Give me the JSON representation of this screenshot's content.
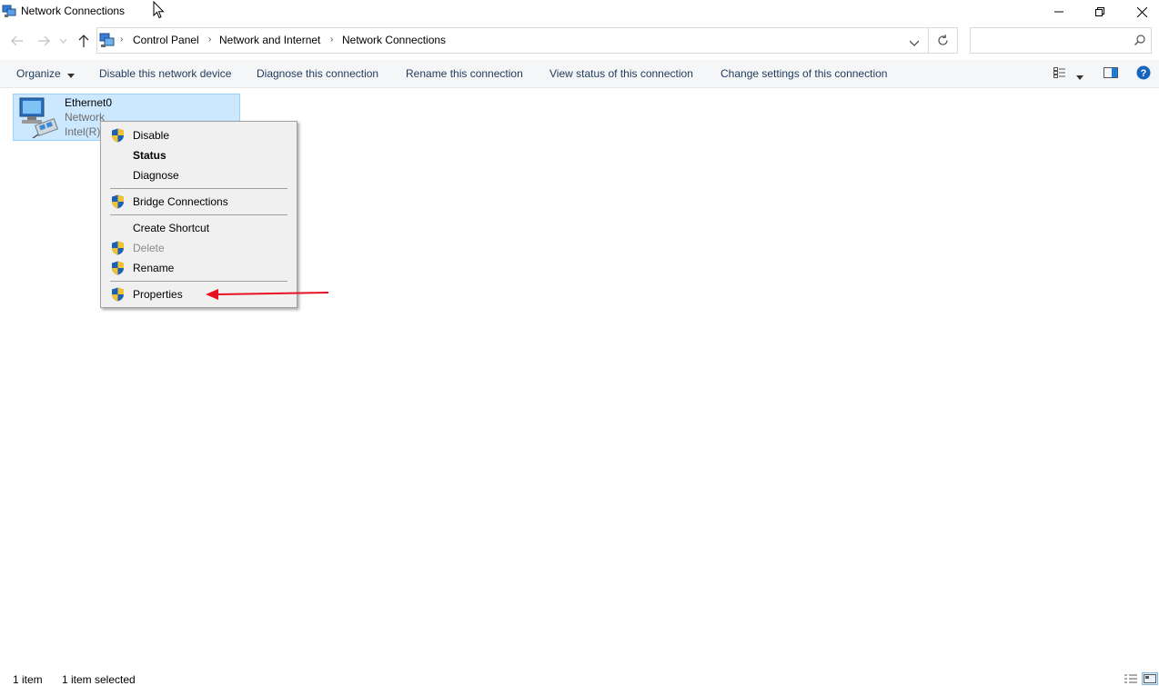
{
  "window": {
    "title": "Network Connections"
  },
  "breadcrumb": {
    "items": [
      "Control Panel",
      "Network and Internet",
      "Network Connections"
    ],
    "separator": "›"
  },
  "search": {
    "placeholder": "",
    "value": ""
  },
  "commandbar": {
    "organize": "Organize",
    "disable": "Disable this network device",
    "diagnose": "Diagnose this connection",
    "rename": "Rename this connection",
    "view_status": "View status of this connection",
    "change_settings": "Change settings of this connection"
  },
  "connection": {
    "name": "Ethernet0",
    "line2": "Network",
    "line3": "Intel(R)"
  },
  "context_menu": {
    "items": [
      {
        "label": "Disable",
        "shield": true,
        "bold": false,
        "disabled": false
      },
      {
        "label": "Status",
        "shield": false,
        "bold": true,
        "disabled": false
      },
      {
        "label": "Diagnose",
        "shield": false,
        "bold": false,
        "disabled": false
      },
      {
        "label": "Bridge Connections",
        "shield": true,
        "bold": false,
        "disabled": false
      },
      {
        "label": "Create Shortcut",
        "shield": false,
        "bold": false,
        "disabled": false
      },
      {
        "label": "Delete",
        "shield": true,
        "bold": false,
        "disabled": true
      },
      {
        "label": "Rename",
        "shield": true,
        "bold": false,
        "disabled": false
      },
      {
        "label": "Properties",
        "shield": true,
        "bold": false,
        "disabled": false
      }
    ]
  },
  "annotation": {
    "color": "#e81123"
  },
  "status": {
    "count": "1 item",
    "selected": "1 item selected"
  },
  "colors": {
    "selection_bg": "#cce8ff",
    "selection_border": "#99d1ff",
    "help_blue": "#1565c0"
  }
}
